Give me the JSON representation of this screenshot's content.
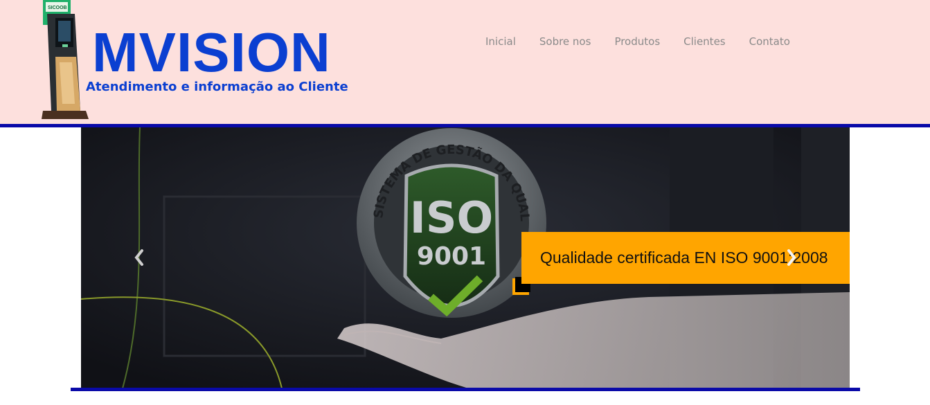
{
  "header": {
    "brand": "MVISION",
    "tagline": "Atendimento e informação ao Cliente",
    "kiosk_label": "SICOOB"
  },
  "nav": {
    "items": [
      {
        "label": "Inicial"
      },
      {
        "label": "Sobre nos"
      },
      {
        "label": "Produtos"
      },
      {
        "label": "Clientes"
      },
      {
        "label": "Contato"
      }
    ]
  },
  "slider": {
    "caption": "Qualidade certificada EN ISO 9001:2008",
    "badge": {
      "ring_text": "SISTEMA DE GESTÃO DA QUALIDADE",
      "iso": "ISO",
      "number": "9001"
    }
  },
  "colors": {
    "header_bg": "#fde0dd",
    "brand_blue": "#0b3fd1",
    "rule_blue": "#0a0aa8",
    "caption_orange": "#ffa500",
    "nav_text": "#8a8a8a"
  },
  "icons": {
    "prev": "chevron-left-icon",
    "next": "chevron-right-icon",
    "check": "check-icon"
  }
}
